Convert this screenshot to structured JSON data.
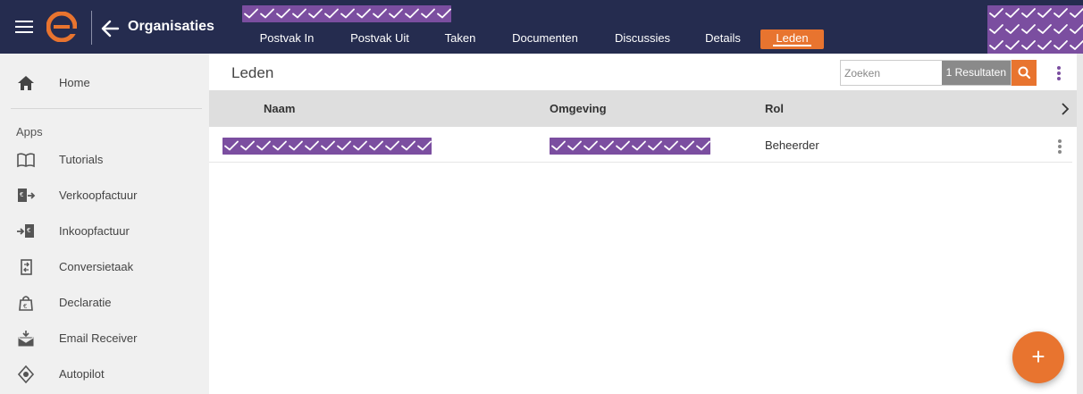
{
  "header": {
    "title": "Organisaties",
    "tabs": [
      {
        "label": "Postvak In"
      },
      {
        "label": "Postvak Uit"
      },
      {
        "label": "Taken"
      },
      {
        "label": "Documenten"
      },
      {
        "label": "Discussies"
      },
      {
        "label": "Details"
      },
      {
        "label": "Leden"
      }
    ],
    "active_tab": "Leden"
  },
  "sidebar": {
    "home": {
      "label": "Home",
      "icon": "home-icon"
    },
    "apps_header": "Apps",
    "items": [
      {
        "label": "Tutorials",
        "icon": "book-icon"
      },
      {
        "label": "Verkoopfactuur",
        "icon": "invoice-out-icon"
      },
      {
        "label": "Inkoopfactuur",
        "icon": "invoice-in-icon"
      },
      {
        "label": "Conversietaak",
        "icon": "convert-icon"
      },
      {
        "label": "Declaratie",
        "icon": "expense-bag-icon"
      },
      {
        "label": "Email Receiver",
        "icon": "email-receiver-icon"
      },
      {
        "label": "Autopilot",
        "icon": "autopilot-icon"
      }
    ]
  },
  "main": {
    "title": "Leden",
    "search": {
      "placeholder": "Zoeken",
      "value": ""
    },
    "results_label": "1 Resultaten",
    "columns": [
      "Naam",
      "Omgeving",
      "Rol"
    ],
    "rows": [
      {
        "naam": "",
        "omgeving": "",
        "rol": "Beheerder"
      }
    ]
  },
  "colors": {
    "topbar": "#252c4f",
    "accent": "#e8742f",
    "redaction": "#7b4ea0",
    "sidebar": "#f0f0f0",
    "table_header": "#dedede",
    "kebab": "#7b4ea0"
  }
}
